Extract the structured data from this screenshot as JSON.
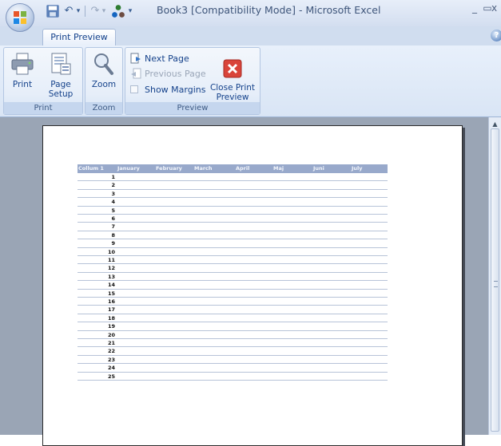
{
  "window": {
    "title": "Book3  [Compatibility Mode] - Microsoft Excel",
    "controls": {
      "minimize": "_",
      "restore": "▭",
      "close": "x"
    }
  },
  "quick_access": {
    "save_icon": "save-icon",
    "undo_glyph": "↶",
    "redo_glyph": "↷",
    "customize_glyph": "▾"
  },
  "tabs": [
    {
      "label": "Print Preview",
      "active": true
    }
  ],
  "ribbon": {
    "groups": {
      "print": {
        "label": "Print",
        "buttons": [
          {
            "label": "Print",
            "icon": "printer-icon"
          },
          {
            "label": "Page\nSetup",
            "icon": "page-setup-icon"
          }
        ]
      },
      "zoom": {
        "label": "Zoom",
        "buttons": [
          {
            "label": "Zoom",
            "icon": "magnifier-icon"
          }
        ]
      },
      "preview": {
        "label": "Preview",
        "small_buttons": [
          {
            "label": "Next Page",
            "enabled": true,
            "icon": "next-page-icon"
          },
          {
            "label": "Previous Page",
            "enabled": false,
            "icon": "previous-page-icon"
          },
          {
            "label": "Show Margins",
            "enabled": true,
            "icon": "checkbox-icon",
            "checked": false
          }
        ],
        "close_button": {
          "label": "Close Print\nPreview",
          "icon": "close-red-icon"
        }
      }
    }
  },
  "sheet": {
    "columns": [
      "Collum 1",
      "January",
      "February",
      "March",
      "April",
      "Maj",
      "Juni",
      "July"
    ],
    "rows": [
      "1",
      "2",
      "3",
      "4",
      "5",
      "6",
      "7",
      "8",
      "9",
      "10",
      "11",
      "12",
      "13",
      "14",
      "15",
      "16",
      "17",
      "18",
      "19",
      "20",
      "21",
      "22",
      "23",
      "24",
      "25"
    ]
  },
  "colors": {
    "header_fill": "#98a9cb",
    "ribbon_text": "#15428b",
    "preview_background": "#9aa5b5",
    "close_button_red": "#d9443a"
  }
}
